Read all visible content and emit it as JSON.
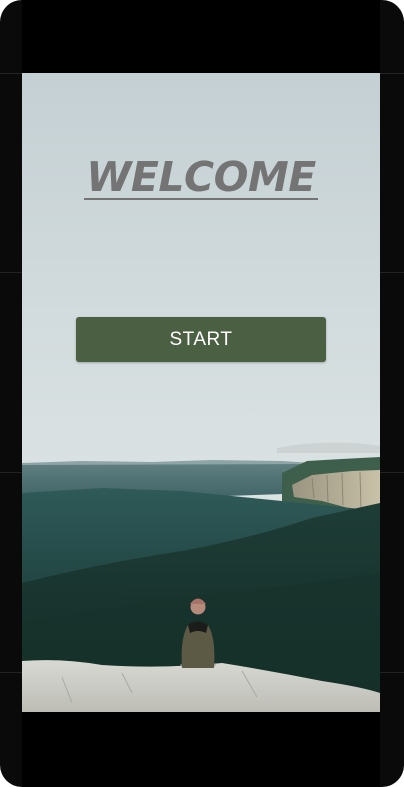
{
  "screen": {
    "title": "WELCOME",
    "start_button_label": "START"
  },
  "colors": {
    "button_background": "#4b5f42",
    "button_text": "#ffffff",
    "title_color": "#747474",
    "device_frame": "#0a0a0a"
  },
  "background_image": {
    "subject": "person-sitting-on-cliff-overlooking-forested-valley"
  }
}
